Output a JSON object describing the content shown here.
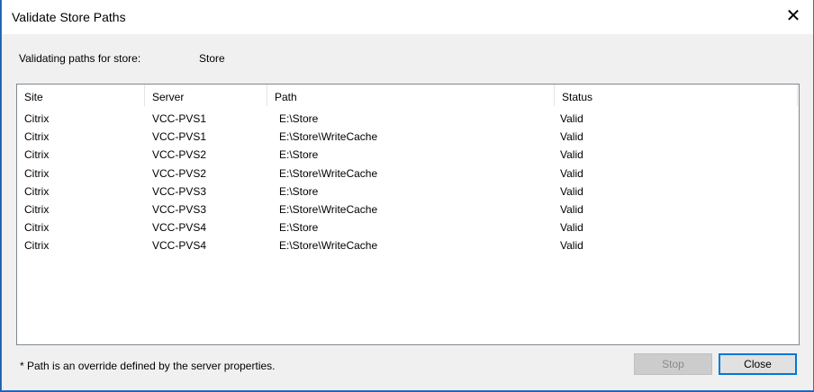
{
  "window": {
    "title": "Validate Store Paths",
    "close_icon": "close-icon"
  },
  "store": {
    "label": "Validating paths for store:",
    "value": "Store"
  },
  "table": {
    "columns": [
      "Site",
      "Server",
      "Path",
      "Status"
    ],
    "rows": [
      [
        "Citrix",
        "VCC-PVS1",
        "E:\\Store",
        "Valid"
      ],
      [
        "Citrix",
        "VCC-PVS1",
        "E:\\Store\\WriteCache",
        "Valid"
      ],
      [
        "Citrix",
        "VCC-PVS2",
        "E:\\Store",
        "Valid"
      ],
      [
        "Citrix",
        "VCC-PVS2",
        "E:\\Store\\WriteCache",
        "Valid"
      ],
      [
        "Citrix",
        "VCC-PVS3",
        "E:\\Store",
        "Valid"
      ],
      [
        "Citrix",
        "VCC-PVS3",
        "E:\\Store\\WriteCache",
        "Valid"
      ],
      [
        "Citrix",
        "VCC-PVS4",
        "E:\\Store",
        "Valid"
      ],
      [
        "Citrix",
        "VCC-PVS4",
        "E:\\Store\\WriteCache",
        "Valid"
      ]
    ]
  },
  "footer": {
    "note": "* Path is an override defined by the server properties.",
    "stop_label": "Stop",
    "close_label": "Close"
  }
}
